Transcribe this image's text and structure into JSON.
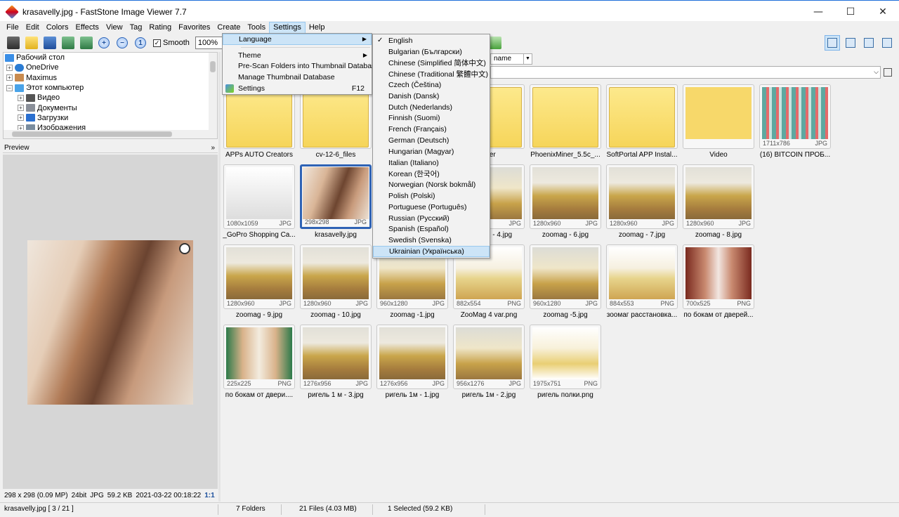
{
  "window": {
    "title": "krasavelly.jpg  -  FastStone Image Viewer 7.7",
    "minimize": "—",
    "maximize": "☐",
    "close": "✕"
  },
  "menu": [
    "File",
    "Edit",
    "Colors",
    "Effects",
    "View",
    "Tag",
    "Rating",
    "Favorites",
    "Create",
    "Tools",
    "Settings",
    "Help"
  ],
  "toolbar": {
    "smooth_label": "Smooth",
    "zoom_value": "100%"
  },
  "tree": {
    "items": [
      {
        "label": "Рабочий стол",
        "level": 0,
        "expand": ""
      },
      {
        "label": "OneDrive",
        "level": 1,
        "expand": "+"
      },
      {
        "label": "Maximus",
        "level": 1,
        "expand": "+"
      },
      {
        "label": "Этот компьютер",
        "level": 1,
        "expand": "−"
      },
      {
        "label": "Видео",
        "level": 2,
        "expand": "+"
      },
      {
        "label": "Документы",
        "level": 2,
        "expand": "+"
      },
      {
        "label": "Загрузки",
        "level": 2,
        "expand": "+"
      },
      {
        "label": "Изображения",
        "level": 2,
        "expand": "+"
      }
    ]
  },
  "preview": {
    "title": "Preview",
    "collapse": "»",
    "info": [
      "298 x 298 (0.09 MP)",
      "24bit",
      "JPG",
      "59.2 KB",
      "2021-03-22 00:18:22",
      "1:1"
    ]
  },
  "sort_value": "name",
  "settings_menu": {
    "items": [
      {
        "label": "Language",
        "submenu": true,
        "highlight": true
      },
      {
        "separator": true
      },
      {
        "label": "Theme",
        "submenu": true
      },
      {
        "label": "Pre-Scan Folders into Thumbnail Database"
      },
      {
        "label": "Manage Thumbnail Database"
      },
      {
        "label": "Settings",
        "shortcut": "F12",
        "icon": true
      }
    ]
  },
  "language_menu": {
    "items": [
      {
        "label": "English",
        "checked": true
      },
      {
        "label": "Bulgarian (Български)"
      },
      {
        "label": "Chinese (Simplified 简体中文)"
      },
      {
        "label": "Chinese (Traditional 繁體中文)"
      },
      {
        "label": "Czech (Čeština)"
      },
      {
        "label": "Danish (Dansk)"
      },
      {
        "label": "Dutch (Nederlands)"
      },
      {
        "label": "Finnish (Suomi)"
      },
      {
        "label": "French (Français)"
      },
      {
        "label": "German (Deutsch)"
      },
      {
        "label": "Hungarian (Magyar)"
      },
      {
        "label": "Italian (Italiano)"
      },
      {
        "label": "Korean (한국어)"
      },
      {
        "label": "Norwegian (Norsk bokmål)"
      },
      {
        "label": "Polish (Polski)"
      },
      {
        "label": "Portuguese (Português)"
      },
      {
        "label": "Russian (Русский)"
      },
      {
        "label": "Spanish (Español)"
      },
      {
        "label": "Swedish (Svenska)"
      },
      {
        "label": "Ukrainian (Українська)",
        "highlight": true
      }
    ]
  },
  "thumbs": [
    {
      "name": "APPs AUTO Creators",
      "dims": "",
      "type": "",
      "kind": "folder"
    },
    {
      "name": "cv-12-6_files",
      "dims": "",
      "type": "",
      "kind": "folder"
    },
    {
      "name": "ayer",
      "dims": "",
      "type": "",
      "kind": "folder"
    },
    {
      "name": "PhoenixMiner_5.5c_...",
      "dims": "",
      "type": "",
      "kind": "folder"
    },
    {
      "name": "SoftPortal APP Instal...",
      "dims": "",
      "type": "",
      "kind": "folder"
    },
    {
      "name": "Video",
      "dims": "",
      "type": "",
      "kind": "video"
    },
    {
      "name": "(16) BITCOIN ПРОБ...",
      "dims": "1711x786",
      "type": "JPG",
      "kind": "sheet"
    },
    {
      "name": "_GoPro Shopping Ca...",
      "dims": "1080x1059",
      "type": "JPG",
      "kind": "shot"
    },
    {
      "name": "krasavelly.jpg",
      "dims": "298x298",
      "type": "JPG",
      "kind": "portrait",
      "selected": true
    },
    {
      "name": "- 3.jpg",
      "dims": "",
      "type": "JPG",
      "kind": "room"
    },
    {
      "name": "zoomag - 4.jpg",
      "dims": "960x1280",
      "type": "JPG",
      "kind": "room-v"
    },
    {
      "name": "zoomag - 6.jpg",
      "dims": "1280x960",
      "type": "JPG",
      "kind": "room"
    },
    {
      "name": "zoomag - 7.jpg",
      "dims": "1280x960",
      "type": "JPG",
      "kind": "room"
    },
    {
      "name": "zoomag - 8.jpg",
      "dims": "1280x960",
      "type": "JPG",
      "kind": "room"
    },
    {
      "name": "zoomag - 9.jpg",
      "dims": "1280x960",
      "type": "JPG",
      "kind": "room"
    },
    {
      "name": "zoomag - 10.jpg",
      "dims": "1280x960",
      "type": "JPG",
      "kind": "room"
    },
    {
      "name": "zoomag -1.jpg",
      "dims": "960x1280",
      "type": "JPG",
      "kind": "room-v"
    },
    {
      "name": "ZooMag 4 var.png",
      "dims": "882x554",
      "type": "PNG",
      "kind": "diagram"
    },
    {
      "name": "zoomag -5.jpg",
      "dims": "960x1280",
      "type": "JPG",
      "kind": "room-v"
    },
    {
      "name": "зоомаг расстановка...",
      "dims": "884x553",
      "type": "PNG",
      "kind": "diagram"
    },
    {
      "name": "по бокам от дверей...",
      "dims": "700x525",
      "type": "PNG",
      "kind": "shop"
    },
    {
      "name": "по бокам от двери....",
      "dims": "225x225",
      "type": "PNG",
      "kind": "shop2"
    },
    {
      "name": "ригель 1 м - 3.jpg",
      "dims": "1276x956",
      "type": "JPG",
      "kind": "room"
    },
    {
      "name": "ригель 1м - 1.jpg",
      "dims": "1276x956",
      "type": "JPG",
      "kind": "room"
    },
    {
      "name": "ригель 1м - 2.jpg",
      "dims": "956x1276",
      "type": "JPG",
      "kind": "room-v"
    },
    {
      "name": "ригель полки.png",
      "dims": "1975x751",
      "type": "PNG",
      "kind": "shelf"
    }
  ],
  "status": {
    "file": "krasavelly.jpg [ 3 / 21 ]",
    "folders": "7 Folders",
    "files": "21 Files (4.03 MB)",
    "selected": "1 Selected (59.2 KB)"
  }
}
